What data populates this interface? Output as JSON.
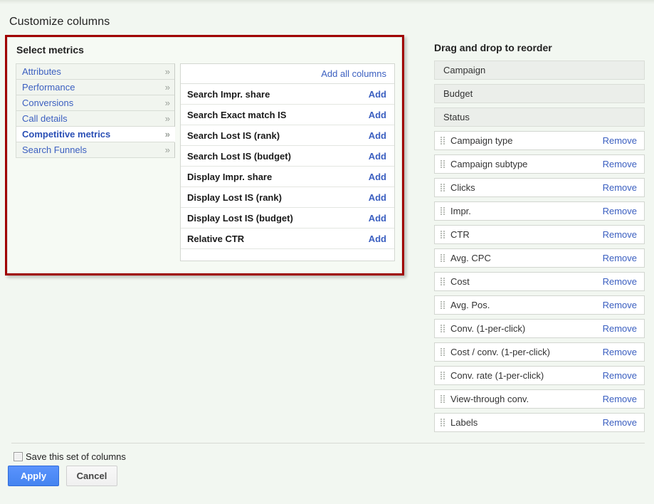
{
  "page": {
    "title": "Customize columns"
  },
  "select_metrics": {
    "heading": "Select metrics",
    "categories": [
      {
        "label": "Attributes",
        "chevron": "»",
        "selected": false
      },
      {
        "label": "Performance",
        "chevron": "»",
        "selected": false
      },
      {
        "label": "Conversions",
        "chevron": "»",
        "selected": false
      },
      {
        "label": "Call details",
        "chevron": "»",
        "selected": false
      },
      {
        "label": "Competitive metrics",
        "chevron": "»",
        "selected": true
      },
      {
        "label": "Search Funnels",
        "chevron": "»",
        "selected": false
      }
    ],
    "add_all_label": "Add all columns",
    "add_label": "Add",
    "metrics": [
      {
        "name": "Search Impr. share",
        "action": "Add"
      },
      {
        "name": "Search Exact match IS",
        "action": "Add"
      },
      {
        "name": "Search Lost IS (rank)",
        "action": "Add"
      },
      {
        "name": "Search Lost IS (budget)",
        "action": "Add"
      },
      {
        "name": "Display Impr. share",
        "action": "Add"
      },
      {
        "name": "Display Lost IS (rank)",
        "action": "Add"
      },
      {
        "name": "Display Lost IS (budget)",
        "action": "Add"
      },
      {
        "name": "Relative CTR",
        "action": "Add"
      }
    ]
  },
  "reorder": {
    "heading": "Drag and drop to reorder",
    "remove_label": "Remove",
    "rows": [
      {
        "label": "Campaign",
        "locked": true
      },
      {
        "label": "Budget",
        "locked": true
      },
      {
        "label": "Status",
        "locked": true
      },
      {
        "label": "Campaign type",
        "locked": false,
        "action": "Remove"
      },
      {
        "label": "Campaign subtype",
        "locked": false,
        "action": "Remove"
      },
      {
        "label": "Clicks",
        "locked": false,
        "action": "Remove"
      },
      {
        "label": "Impr.",
        "locked": false,
        "action": "Remove"
      },
      {
        "label": "CTR",
        "locked": false,
        "action": "Remove"
      },
      {
        "label": "Avg. CPC",
        "locked": false,
        "action": "Remove"
      },
      {
        "label": "Cost",
        "locked": false,
        "action": "Remove"
      },
      {
        "label": "Avg. Pos.",
        "locked": false,
        "action": "Remove"
      },
      {
        "label": "Conv. (1-per-click)",
        "locked": false,
        "action": "Remove"
      },
      {
        "label": "Cost / conv. (1-per-click)",
        "locked": false,
        "action": "Remove"
      },
      {
        "label": "Conv. rate (1-per-click)",
        "locked": false,
        "action": "Remove"
      },
      {
        "label": "View-through conv.",
        "locked": false,
        "action": "Remove"
      },
      {
        "label": "Labels",
        "locked": false,
        "action": "Remove"
      }
    ]
  },
  "footer": {
    "save_checkbox_label": "Save this set of columns",
    "save_checkbox_checked": false,
    "apply_label": "Apply",
    "cancel_label": "Cancel"
  },
  "colors": {
    "highlight_border": "#a00000",
    "link": "#3b5fc0",
    "apply_button": "#4584f0",
    "background": "#f2f7f1"
  }
}
